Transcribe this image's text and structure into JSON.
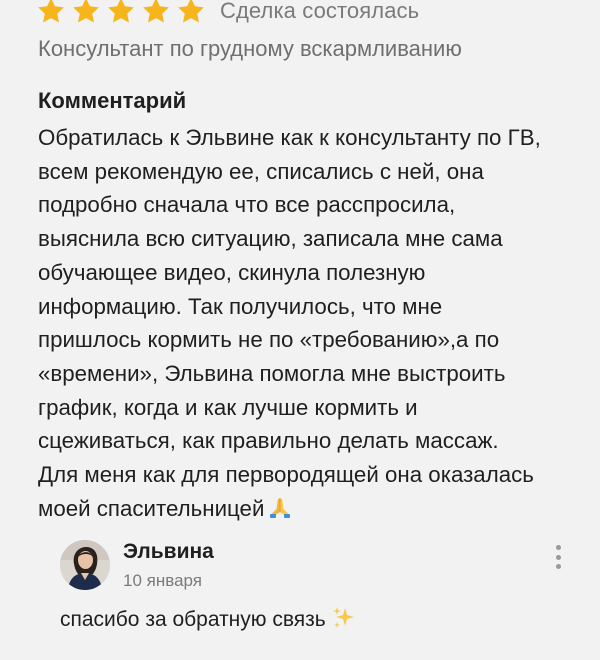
{
  "review": {
    "rating": 5,
    "rating_max": 5,
    "star_color": "#f7b51d",
    "deal_status": "Сделка состоялась",
    "service": "Консультант по грудному вскармливанию",
    "comment_heading": "Комментарий",
    "comment_text": "Обратилась к Эльвине как к консультанту по ГВ,\nвсем рекомендую ее, списались с ней, она\nподробно сначала что все расспросила,\nвыяснила всю ситуацию, записала мне сама\nобучающее видео, скинула полезную\nинформацию. Так получилось, что мне\nпришлось  кормить не по «требованию»,а по\n«времени», Эльвина помогла мне выстроить\nграфик, когда и как лучше кормить и\nсцеживаться, как правильно делать массаж.\nДля меня как для первородящей она оказалась\nмоей спасительницей",
    "comment_emoji": "folded-hands-icon"
  },
  "reply": {
    "author": "Эльвина",
    "date": "10 января",
    "text": "спасибо за обратную связь",
    "text_emoji": "sparkles-icon",
    "more_icon": "more-vertical-icon"
  }
}
